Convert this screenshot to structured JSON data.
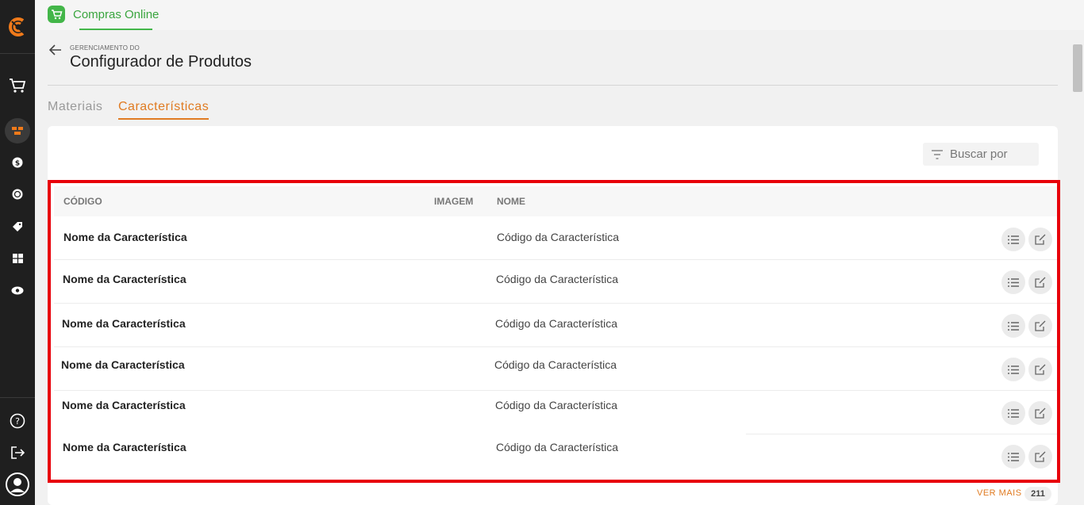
{
  "app": {
    "name": "Compras Online",
    "brand_color": "#43b649",
    "accent_color": "#e07b22"
  },
  "sidebar": {
    "items": [
      {
        "icon": "cart-icon"
      },
      {
        "icon": "building-blocks-icon",
        "active": true
      },
      {
        "icon": "dollar-coin-icon"
      },
      {
        "icon": "exchange-coin-icon"
      },
      {
        "icon": "tag-icon"
      },
      {
        "icon": "grid-icon"
      },
      {
        "icon": "eye-icon"
      }
    ],
    "bottom": [
      {
        "icon": "help-icon"
      },
      {
        "icon": "logout-icon"
      },
      {
        "icon": "user-avatar-icon"
      }
    ]
  },
  "header": {
    "eyebrow": "GERENCIAMENTO DO",
    "title": "Configurador de Produtos"
  },
  "tabs": [
    {
      "label": "Materiais",
      "active": false
    },
    {
      "label": "Características",
      "active": true
    }
  ],
  "search": {
    "placeholder": "Buscar por"
  },
  "table": {
    "columns": [
      "CÓDIGO",
      "IMAGEM",
      "NOME"
    ],
    "rows": [
      {
        "codigo": "Nome da Característica",
        "nome": "Código da Característica"
      },
      {
        "codigo": "Nome da Característica",
        "nome": "Código da Característica"
      },
      {
        "codigo": "Nome da Característica",
        "nome": "Código da Característica"
      },
      {
        "codigo": "Nome da Característica",
        "nome": "Código da Característica"
      },
      {
        "codigo": "Nome da Característica",
        "nome": "Código da Característica"
      },
      {
        "codigo": "Nome da Característica",
        "nome": "Código da Característica"
      }
    ]
  },
  "pagination": {
    "more_label": "VER MAIS",
    "count": "211"
  }
}
